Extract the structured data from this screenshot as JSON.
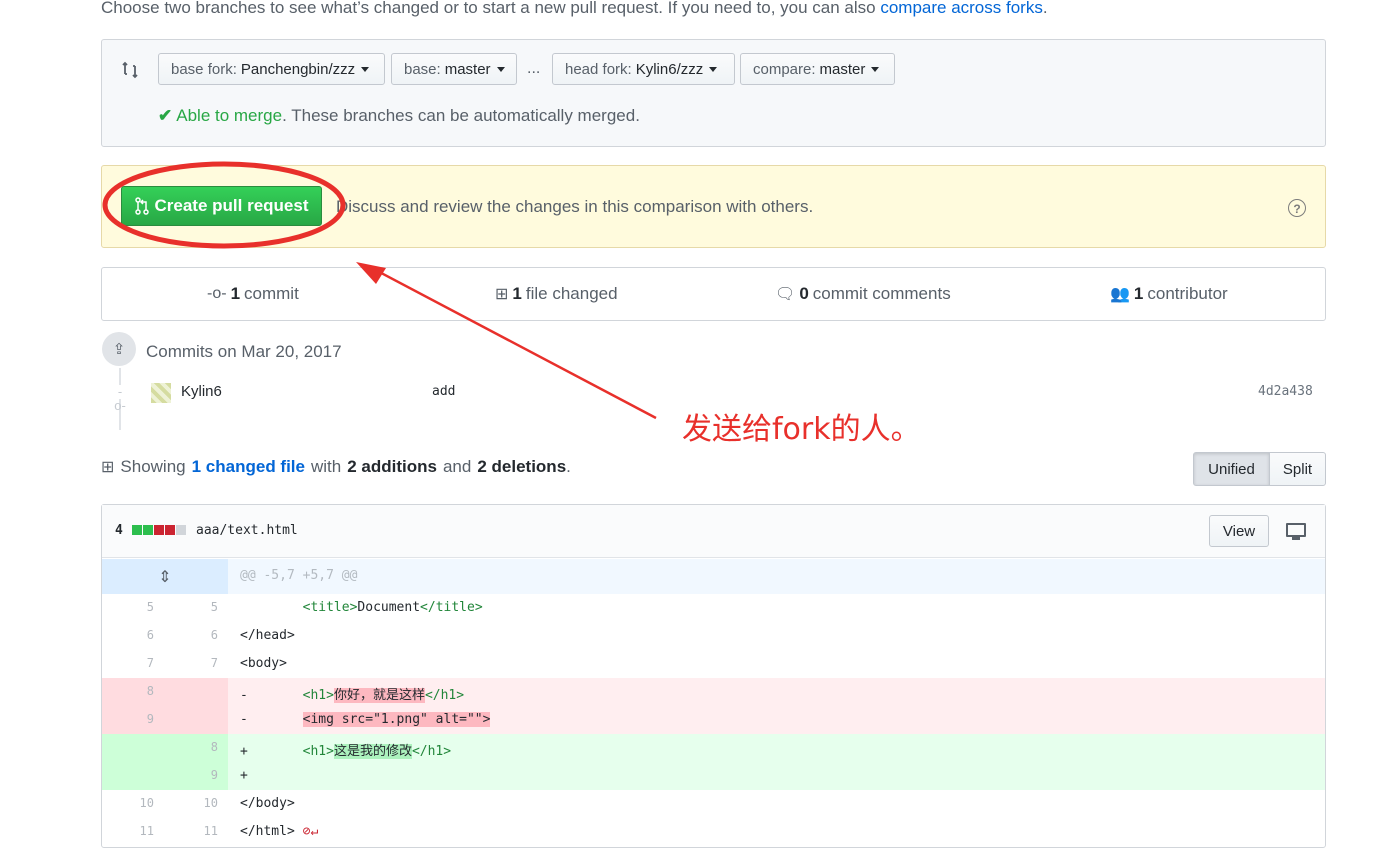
{
  "intro": {
    "text": "Choose two branches to see what’s changed or to start a new pull request. If you need to, you can also ",
    "link": "compare across forks",
    "end": "."
  },
  "range": {
    "base_fork_label": "base fork:",
    "base_fork_value": "Panchengbin/zzz",
    "base_label": "base:",
    "base_value": "master",
    "dots": "...",
    "head_fork_label": "head fork:",
    "head_fork_value": "Kylin6/zzz",
    "compare_label": "compare:",
    "compare_value": "master",
    "merge_ok": "Able to merge",
    "merge_rest": ". These branches can be automatically merged."
  },
  "pr": {
    "button": "Create pull request",
    "note": "Discuss and review the changes in this comparison with others."
  },
  "stats": {
    "commits_num": "1",
    "commits_label": "commit",
    "files_num": "1",
    "files_label": "file changed",
    "comments_num": "0",
    "comments_label": "commit comments",
    "contributors_num": "1",
    "contributors_label": "contributor"
  },
  "commits": {
    "date": "Commits on Mar 20, 2017",
    "author": "Kylin6",
    "message": "add",
    "sha": "4d2a438"
  },
  "summary": {
    "showing": "Showing",
    "changed": "1 changed file",
    "with": "with",
    "additions": "2 additions",
    "and": "and",
    "deletions": "2 deletions",
    "period": "."
  },
  "view_mode": {
    "unified": "Unified",
    "split": "Split"
  },
  "file": {
    "diffstat": "4",
    "name": "aaa/text.html",
    "view": "View",
    "hunk": "@@ -5,7 +5,7 @@",
    "lines": [
      {
        "type": "ctx",
        "old": "5",
        "new": "5"
      },
      {
        "type": "ctx",
        "old": "6",
        "new": "6"
      },
      {
        "type": "ctx",
        "old": "7",
        "new": "7"
      },
      {
        "type": "del",
        "old": "8",
        "new": ""
      },
      {
        "type": "del",
        "old": "9",
        "new": ""
      },
      {
        "type": "add",
        "old": "",
        "new": "8"
      },
      {
        "type": "add",
        "old": "",
        "new": "9"
      },
      {
        "type": "ctx",
        "old": "10",
        "new": "10"
      },
      {
        "type": "ctx",
        "old": "11",
        "new": "11"
      }
    ],
    "code": {
      "l5_open": "<title>",
      "l5_text": "Document",
      "l5_close": "</title>",
      "l6": "</head>",
      "l7": "<body>",
      "l8_sign": "-",
      "l8_open": "<h1>",
      "l8_text": "你好，就是这样",
      "l8_close": "</h1>",
      "l9_sign": "-",
      "l9_text": "<img src=\"1.png\" alt=\"\">",
      "a8_sign": "+",
      "a8_open": "<h1>",
      "a8_text": "这是我的修改",
      "a8_close": "</h1>",
      "a9_sign": "+",
      "l10": "</body>",
      "l11": "</html>",
      "l11_nonl": "⊘↵"
    }
  },
  "annotation": {
    "text": "发送给fork的人。",
    "color": "#e8302b"
  }
}
